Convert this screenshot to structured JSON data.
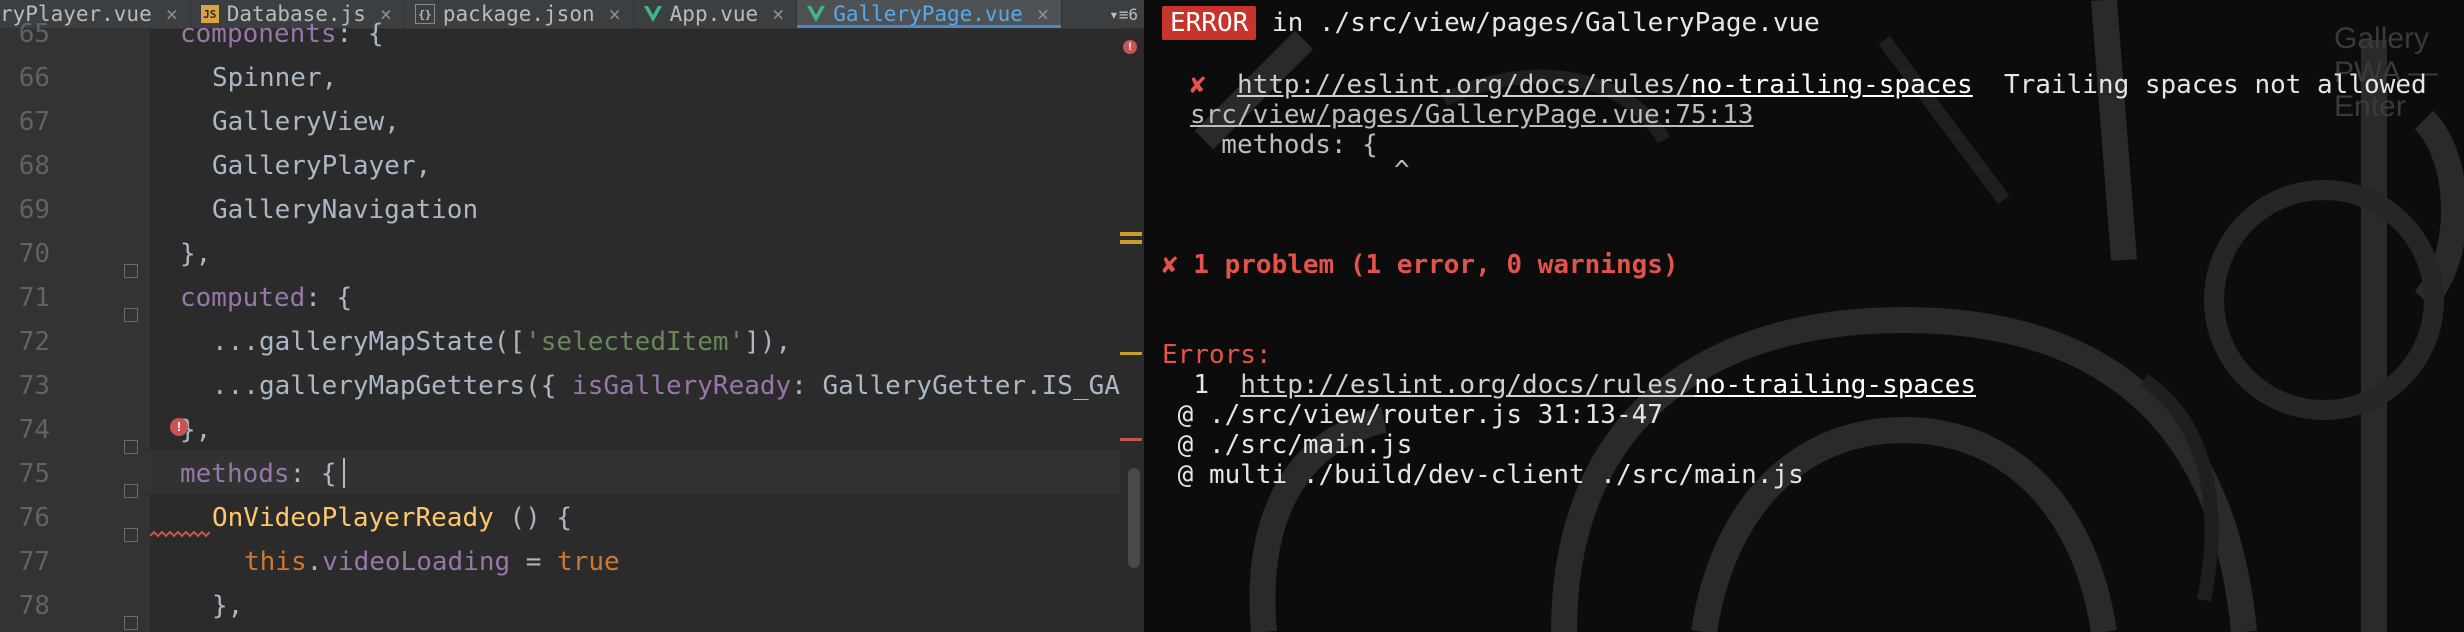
{
  "editor": {
    "tabs": [
      {
        "label": "ryPlayer.vue",
        "icon": "vue-icon",
        "active": false
      },
      {
        "label": "Database.js",
        "icon": "js-file-icon",
        "active": false
      },
      {
        "label": "package.json",
        "icon": "json-file-icon",
        "active": false
      },
      {
        "label": "App.vue",
        "icon": "vue-icon",
        "active": false
      },
      {
        "label": "GalleryPage.vue",
        "icon": "vue-icon",
        "active": true
      }
    ],
    "tab_overflow_count": "6",
    "line_numbers": [
      "65",
      "66",
      "67",
      "68",
      "69",
      "70",
      "71",
      "72",
      "73",
      "74",
      "75",
      "76",
      "77",
      "78"
    ],
    "code": {
      "l65_a": "components",
      "l65_b": ": {",
      "l66": "Spinner,",
      "l67": "GalleryView,",
      "l68": "GalleryPlayer,",
      "l69": "GalleryNavigation",
      "l70": "},",
      "l71_a": "computed",
      "l71_b": ": {",
      "l72_a": "...",
      "l72_b": "galleryMapState",
      "l72_c": "([",
      "l72_d": "'selectedItem'",
      "l72_e": "]),",
      "l73_a": "...",
      "l73_b": "galleryMapGetters",
      "l73_c": "({ ",
      "l73_d": "isGalleryReady",
      "l73_e": ": GalleryGetter.IS_GAL",
      "l74": "},",
      "l75_a": "methods",
      "l75_b": ": {",
      "l76_a": "OnVideoPlayerReady",
      "l76_b": " () {",
      "l77_a": "this",
      "l77_b": ".",
      "l77_c": "videoLoading",
      "l77_d": " = ",
      "l77_e": "true",
      "l78": "},"
    }
  },
  "terminal": {
    "badge": "ERROR",
    "header_path": " in ./src/view/pages/GalleryPage.vue",
    "ghost_text": "Gallery PWA — Enter",
    "cross": "✘",
    "rule_base": "http://eslint.org/docs/rules/",
    "rule_name": "no-trailing-spaces",
    "message": "  Trailing spaces not allowed",
    "location": "src/view/pages/GalleryPage.vue:75:13",
    "snippet": "  methods: {",
    "caret": "^",
    "summary": "✘ 1 problem (1 error, 0 warnings)",
    "errors_label": "Errors:",
    "errors_count": "1",
    "trace": [
      " @ ./src/view/router.js 31:13-47",
      " @ ./src/main.js",
      " @ multi ./build/dev-client ./src/main.js"
    ]
  },
  "colors": {
    "editor_bg": "#2b2b2b",
    "keyword": "#cc7832",
    "property": "#9876aa",
    "function": "#ffc66d",
    "string": "#6a8759",
    "terminal_bg": "#0c0c0c",
    "error_red": "#e4534b",
    "badge_bg": "#c7342c"
  }
}
